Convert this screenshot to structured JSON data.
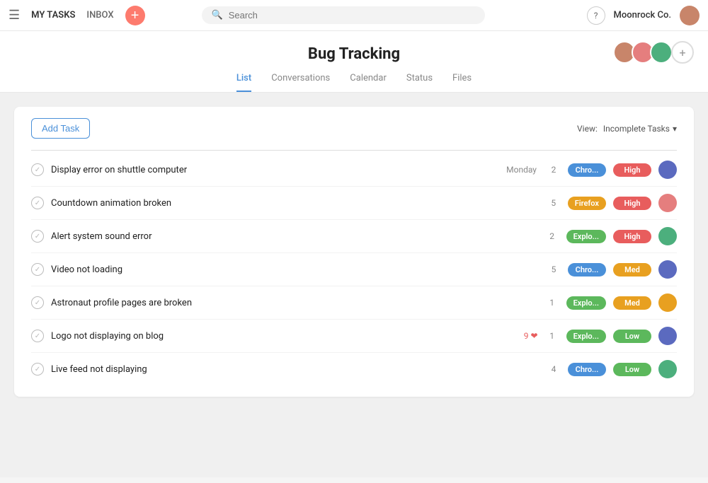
{
  "nav": {
    "my_tasks": "MY TASKS",
    "inbox": "INBOX",
    "search_placeholder": "Search",
    "help": "?",
    "workspace": "Moonrock Co."
  },
  "project": {
    "title": "Bug Tracking",
    "tabs": [
      "List",
      "Conversations",
      "Calendar",
      "Status",
      "Files"
    ],
    "active_tab": 0
  },
  "toolbar": {
    "add_task": "Add Task",
    "view_label": "View:",
    "view_value": "Incomplete Tasks",
    "view_icon": "▾"
  },
  "tasks": [
    {
      "name": "Display error on shuttle computer",
      "day": "Monday",
      "likes": null,
      "count": 2,
      "browser": "Chro...",
      "browser_type": "chrome",
      "priority": "High",
      "priority_type": "high",
      "avatar_color": "#5b6abf"
    },
    {
      "name": "Countdown animation broken",
      "day": null,
      "likes": null,
      "count": 5,
      "browser": "Firefox",
      "browser_type": "firefox",
      "priority": "High",
      "priority_type": "high",
      "avatar_color": "#e57e7e"
    },
    {
      "name": "Alert system sound error",
      "day": null,
      "likes": null,
      "count": 2,
      "browser": "Explo...",
      "browser_type": "explorer",
      "priority": "High",
      "priority_type": "high",
      "avatar_color": "#4caf7d"
    },
    {
      "name": "Video not loading",
      "day": null,
      "likes": null,
      "count": 5,
      "browser": "Chro...",
      "browser_type": "chrome",
      "priority": "Med",
      "priority_type": "med",
      "avatar_color": "#5b6abf"
    },
    {
      "name": "Astronaut profile pages are broken",
      "day": null,
      "likes": null,
      "count": 1,
      "browser": "Explo...",
      "browser_type": "explorer",
      "priority": "Med",
      "priority_type": "med",
      "avatar_color": "#e8a020"
    },
    {
      "name": "Logo not displaying on blog",
      "day": null,
      "likes": 9,
      "count": 1,
      "browser": "Explo...",
      "browser_type": "explorer",
      "priority": "Low",
      "priority_type": "low",
      "avatar_color": "#5b6abf"
    },
    {
      "name": "Live feed not displaying",
      "day": null,
      "likes": null,
      "count": 4,
      "browser": "Chro...",
      "browser_type": "chrome",
      "priority": "Low",
      "priority_type": "low",
      "avatar_color": "#4caf7d"
    }
  ],
  "team": [
    {
      "color": "#e57e7e",
      "initials": ""
    },
    {
      "color": "#e8a020",
      "initials": ""
    },
    {
      "color": "#4caf7d",
      "initials": ""
    }
  ]
}
